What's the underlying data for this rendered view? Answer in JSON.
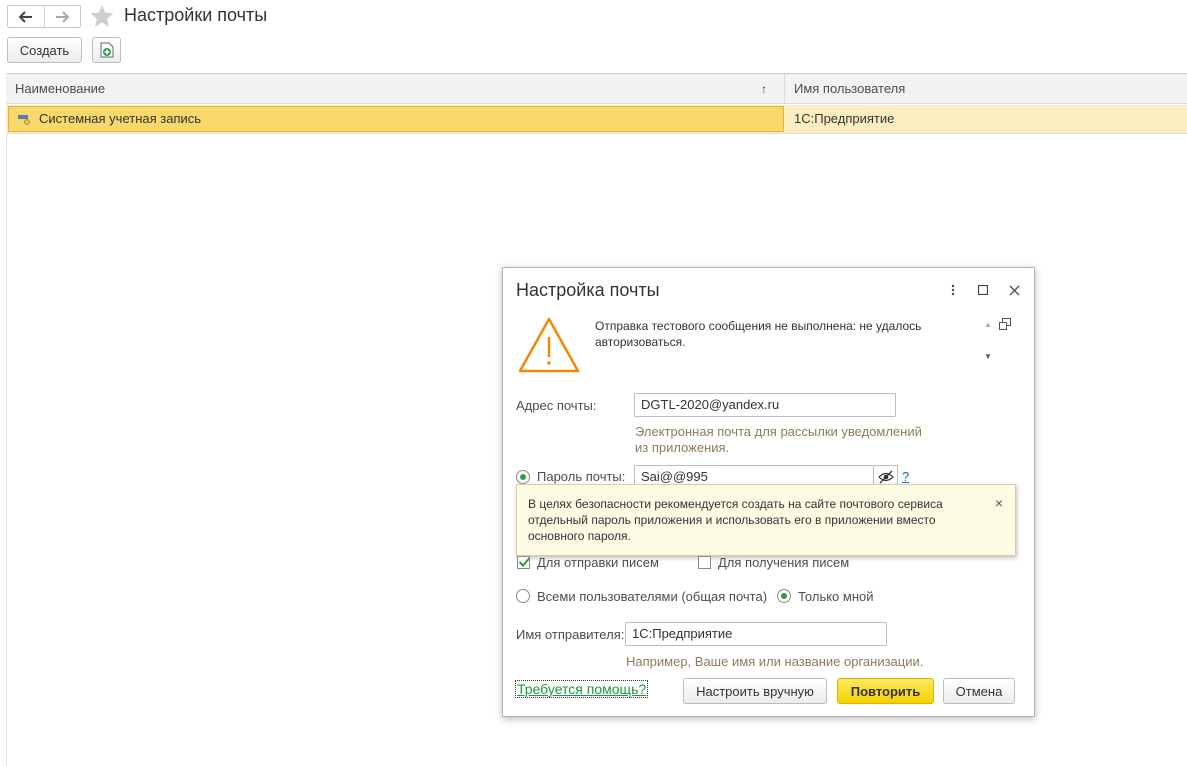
{
  "page": {
    "title": "Настройки почты"
  },
  "toolbar": {
    "create_label": "Создать"
  },
  "table": {
    "columns": [
      "Наименование",
      "Имя пользователя"
    ],
    "sort_indicator": "↑",
    "rows": [
      {
        "name": "Системная учетная запись",
        "user": "1С:Предприятие"
      }
    ]
  },
  "dialog": {
    "title": "Настройка почты",
    "warning": "Отправка тестового сообщения не выполнена: не удалось авторизоваться.",
    "email_label": "Адрес почты:",
    "email_value": "DGTL-2020@yandex.ru",
    "email_hint": "Электронная почта для рассылки уведомлений из приложения.",
    "password_label": "Пароль почты:",
    "password_value": "Sai@@995",
    "help_q": "?",
    "tooltip": "В целях безопасности рекомендуется создать на сайте почтового сервиса отдельный пароль приложения и использовать его в приложении вместо основного пароля.",
    "tooltip_close": "×",
    "send_label": "Для отправки писем",
    "send_checked": true,
    "receive_label": "Для получения писем",
    "receive_checked": false,
    "all_users_label": "Всеми пользователями (общая почта)",
    "only_me_label": "Только мной",
    "sender_label": "Имя отправителя:",
    "sender_value": "1С:Предприятие",
    "sender_hint": "Например, Ваше имя или название организации.",
    "help_link": "Требуется помощь?",
    "manual_button": "Настроить вручную",
    "retry_button": "Повторить",
    "cancel_button": "Отмена"
  },
  "colors": {
    "selection": "#f9d86b",
    "row_bg": "#fbedc0",
    "accent_green": "#2f9a45",
    "primary_button": "#f5d200",
    "warning_orange": "#f08a00"
  }
}
